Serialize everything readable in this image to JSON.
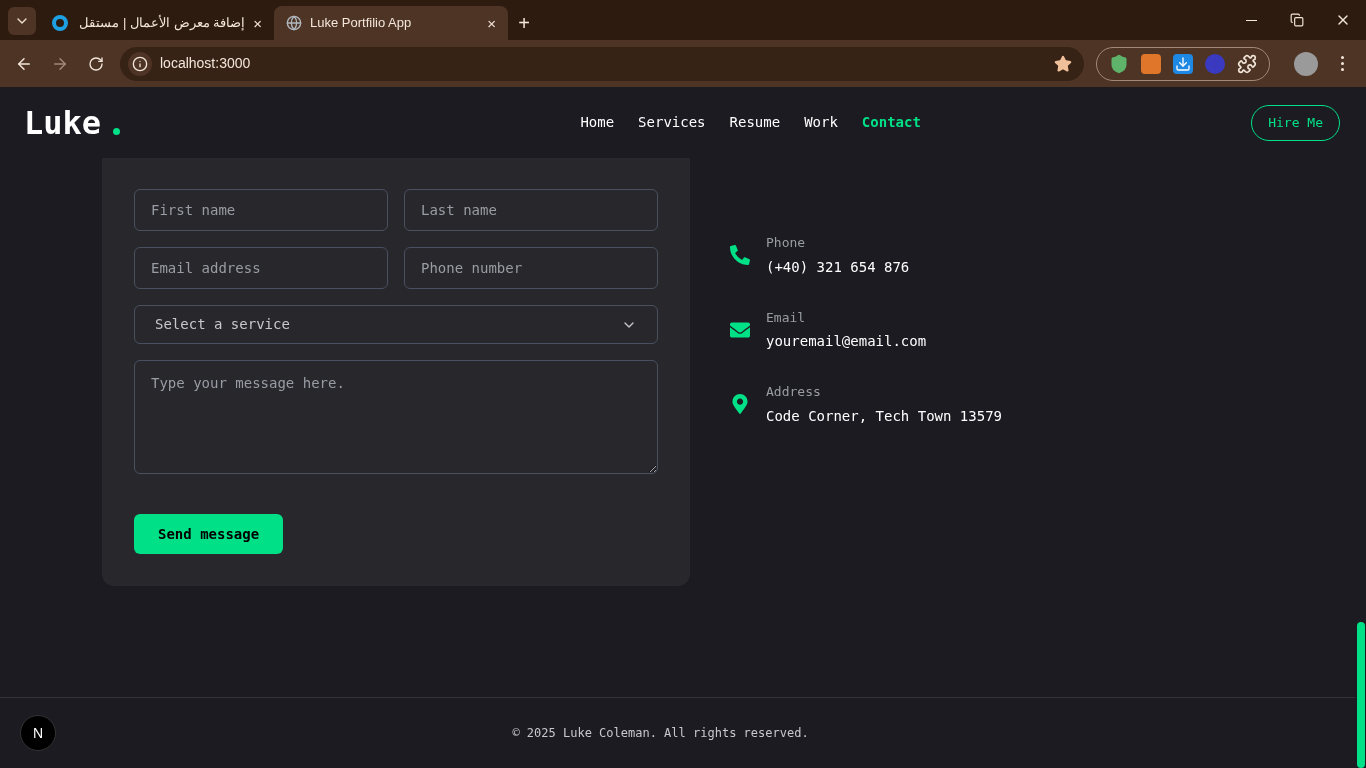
{
  "browser": {
    "tabs": [
      {
        "title": "إضافة معرض الأعمال | مستقل",
        "selected": false,
        "close": "×"
      },
      {
        "title": "Luke Portfilio App",
        "selected": true,
        "close": "×"
      }
    ],
    "new_tab": "+",
    "url": "localhost:3000"
  },
  "nav": {
    "logo": "Luke",
    "links": [
      {
        "label": "Home",
        "selected": false
      },
      {
        "label": "Services",
        "selected": false
      },
      {
        "label": "Resume",
        "selected": false
      },
      {
        "label": "Work",
        "selected": false
      },
      {
        "label": "Contact",
        "selected": true
      }
    ],
    "hire_button": "Hire Me"
  },
  "form": {
    "fields": [
      {
        "placeholder": "First name"
      },
      {
        "placeholder": "Last name"
      },
      {
        "placeholder": "Email address"
      },
      {
        "placeholder": "Phone number"
      }
    ],
    "service_select": "Select a service",
    "message": {
      "placeholder": "Type your message here."
    },
    "submit": "Send message"
  },
  "contact": [
    {
      "kind": "phone",
      "label": "Phone",
      "value": "(+40) 321 654 876"
    },
    {
      "kind": "email",
      "label": "Email",
      "value": "youremail@email.com"
    },
    {
      "kind": "address",
      "label": "Address",
      "value": "Code Corner, Tech Town 13579"
    }
  ],
  "footer": {
    "copyright": "© 2025 Luke Coleman. All rights reserved.",
    "badge": "N"
  }
}
